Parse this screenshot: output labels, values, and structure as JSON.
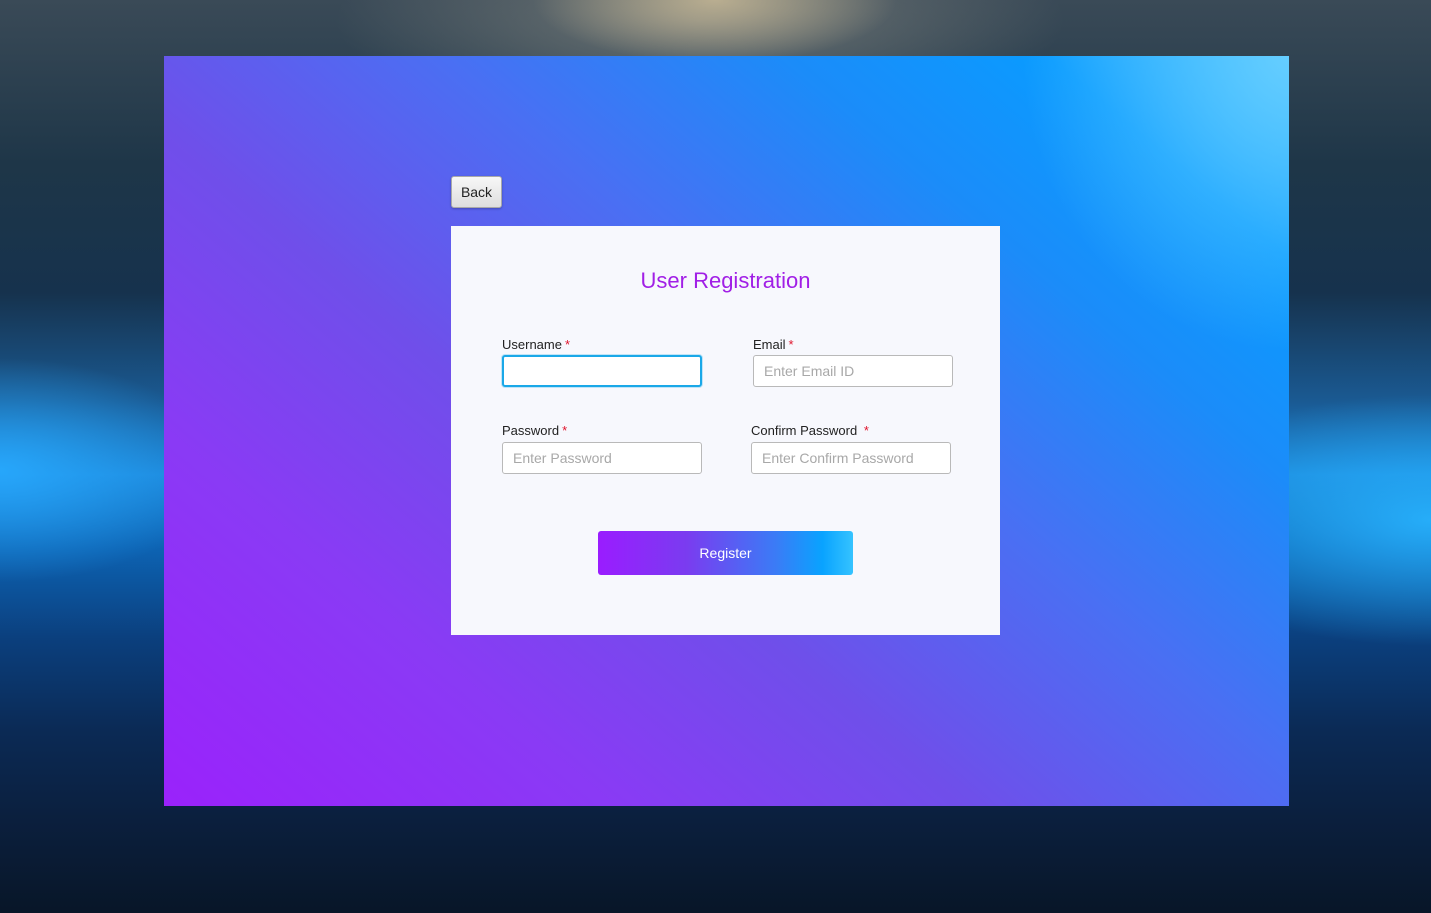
{
  "toolbar": {
    "back_label": "Back"
  },
  "form": {
    "title": "User Registration",
    "required_mark": "*",
    "username": {
      "label": "Username",
      "value": "",
      "placeholder": ""
    },
    "email": {
      "label": "Email",
      "value": "",
      "placeholder": "Enter Email ID"
    },
    "password": {
      "label": "Password",
      "value": "",
      "placeholder": "Enter Password"
    },
    "confirm_password": {
      "label": "Confirm Password ",
      "value": "",
      "placeholder": "Enter Confirm Password"
    },
    "register_label": "Register"
  },
  "colors": {
    "title": "#a11fe6",
    "required": "#e0142c",
    "focus_border": "#1aa8e8",
    "gradient_start": "#9a1cff",
    "gradient_end": "#09a3ff"
  }
}
